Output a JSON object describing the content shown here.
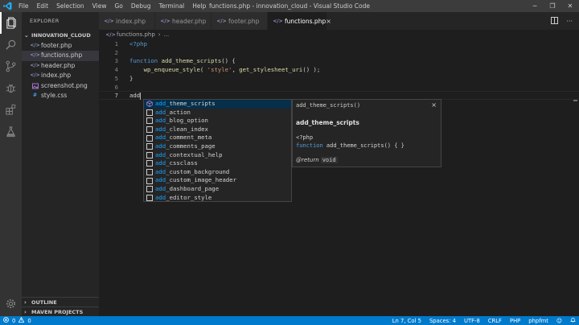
{
  "window": {
    "title": "functions.php - innovation_cloud - Visual Studio Code",
    "minimize": "─",
    "restore": "❐",
    "close": "✕"
  },
  "menu": [
    "File",
    "Edit",
    "Selection",
    "View",
    "Go",
    "Debug",
    "Terminal",
    "Help"
  ],
  "sidebar": {
    "header": "EXPLORER",
    "folder": "INNOVATION_CLOUD",
    "files": [
      {
        "name": "footer.php",
        "type": "php"
      },
      {
        "name": "functions.php",
        "type": "php",
        "selected": true
      },
      {
        "name": "header.php",
        "type": "php"
      },
      {
        "name": "index.php",
        "type": "php"
      },
      {
        "name": "screenshot.png",
        "type": "image"
      },
      {
        "name": "style.css",
        "type": "css"
      }
    ],
    "outline": "OUTLINE",
    "maven": "MAVEN PROJECTS"
  },
  "tabs": [
    {
      "label": "index.php",
      "active": false
    },
    {
      "label": "header.php",
      "active": false
    },
    {
      "label": "footer.php",
      "active": false
    },
    {
      "label": "functions.php",
      "active": true
    }
  ],
  "breadcrumb": {
    "file": "functions.php",
    "more": "..."
  },
  "editor": {
    "lines": [
      {
        "n": "1",
        "text": "<?php"
      },
      {
        "n": "2",
        "text": ""
      },
      {
        "n": "3",
        "text": "function add_theme_scripts() {"
      },
      {
        "n": "4",
        "text": "    wp_enqueue_style( 'style', get_stylesheet_uri() );"
      },
      {
        "n": "5",
        "text": "}"
      },
      {
        "n": "6",
        "text": ""
      },
      {
        "n": "7",
        "text": "add"
      }
    ]
  },
  "suggest": {
    "items": [
      {
        "match": "add",
        "rest": "_theme_scripts",
        "kind": "function"
      },
      {
        "match": "add",
        "rest": "_action",
        "kind": "text"
      },
      {
        "match": "add",
        "rest": "_blog_option",
        "kind": "text"
      },
      {
        "match": "add",
        "rest": "_clean_index",
        "kind": "text"
      },
      {
        "match": "add",
        "rest": "_comment_meta",
        "kind": "text"
      },
      {
        "match": "add",
        "rest": "_comments_page",
        "kind": "text"
      },
      {
        "match": "add",
        "rest": "_contextual_help",
        "kind": "text"
      },
      {
        "match": "add",
        "rest": "_cssclass",
        "kind": "text"
      },
      {
        "match": "add",
        "rest": "_custom_background",
        "kind": "text"
      },
      {
        "match": "add",
        "rest": "_custom_image_header",
        "kind": "text"
      },
      {
        "match": "add",
        "rest": "_dashboard_page",
        "kind": "text"
      },
      {
        "match": "add",
        "rest": "_editor_style",
        "kind": "text"
      }
    ]
  },
  "details": {
    "signature": "add_theme_scripts()",
    "close": "×",
    "title": "add_theme_scripts",
    "code_open": "<?php",
    "code_kw": "function",
    "code_rest": " add_theme_scripts() { }",
    "return_label": "@return",
    "return_type": "void"
  },
  "status": {
    "errors": "0",
    "warnings": "0",
    "position": "Ln 7, Col 5",
    "spaces": "Spaces: 4",
    "encoding": "UTF-8",
    "eol": "CRLF",
    "language": "PHP",
    "formatter": "phpfmt"
  },
  "colors": {
    "accent": "#007acc",
    "activity_bar": "#333333",
    "sidebar": "#252526",
    "editor": "#1e1e1e",
    "match": "#18a3ff"
  }
}
